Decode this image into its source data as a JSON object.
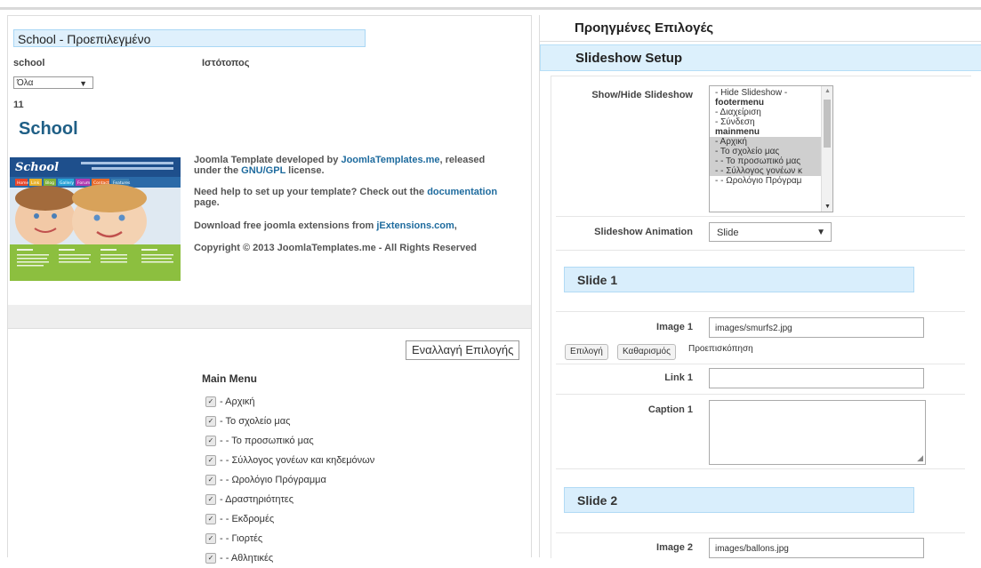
{
  "left_top": {
    "style_title": "School - Προεπιλεγμένο",
    "template_label": "school",
    "site_label": "Ιστότοπος",
    "filter_value": "Όλα",
    "id_value": "11",
    "template_heading": "School",
    "description": {
      "line1_prefix": "Joomla Template developed by ",
      "line1_link": "JoomlaTemplates.me",
      "line1_suffix": ", released",
      "line2_prefix": "under the ",
      "line2_link": "GNU/GPL",
      "line2_suffix": " license.",
      "help_prefix": "Need help to set up your template? Check out the ",
      "help_link": "documentation",
      "help_suffix": "page.",
      "download_prefix": "Download free joomla extensions from ",
      "download_link": "jExtensions.com",
      "download_suffix": ",",
      "copyright": "Copyright © 2013 JoomlaTemplates.me - All Rights Reserved"
    },
    "thumb": {
      "logo": "School",
      "nav": [
        "Home",
        "Link",
        "Blog",
        "Gallery",
        "Forum",
        "Contact",
        "Features"
      ]
    }
  },
  "left_bottom": {
    "toggle_button": "Εναλλαγή Επιλογής",
    "menu_title": "Main Menu",
    "items": [
      "- Αρχική",
      "- Το σχολείο μας",
      "- - Το προσωπικό μας",
      "- - Σύλλογος γονέων και κηδεμόνων",
      "- - Ωρολόγιο Πρόγραμμα",
      "- Δραστηριότητες",
      "- - Εκδρομές",
      "- - Γιορτές",
      "- - Αθλητικές"
    ]
  },
  "right": {
    "advanced_title": "Προηγμένες Επιλογές",
    "slideshow_setup": "Slideshow Setup",
    "show_hide_label": "Show/Hide Slideshow",
    "listbox_options": [
      {
        "text": "- Hide Slideshow -",
        "type": "opt",
        "selected": false
      },
      {
        "text": "footermenu",
        "type": "group",
        "selected": false
      },
      {
        "text": "  - Διαχείριση",
        "type": "opt",
        "selected": false
      },
      {
        "text": "  - Σύνδεση",
        "type": "opt",
        "selected": false
      },
      {
        "text": "mainmenu",
        "type": "group",
        "selected": false
      },
      {
        "text": "- Αρχική",
        "type": "opt",
        "selected": true
      },
      {
        "text": "- Το σχολείο μας",
        "type": "opt",
        "selected": true
      },
      {
        "text": "- - Το προσωπικό μας",
        "type": "opt",
        "selected": true
      },
      {
        "text": "- - Σύλλογος γονέων κ",
        "type": "opt",
        "selected": true
      },
      {
        "text": "- - Ωρολόγιο Πρόγραμ",
        "type": "opt",
        "selected": false
      }
    ],
    "animation_label": "Slideshow Animation",
    "animation_value": "Slide",
    "slide1_title": "Slide 1",
    "image1_label": "Image 1",
    "image1_value": "images/smurfs2.jpg",
    "select_button": "Επιλογή",
    "clear_button": "Καθαρισμός",
    "preview_label": "Προεπισκόπηση",
    "link1_label": "Link 1",
    "link1_value": "",
    "caption1_label": "Caption 1",
    "slide2_title": "Slide 2",
    "image2_label": "Image 2",
    "image2_value": "images/ballons.jpg"
  }
}
